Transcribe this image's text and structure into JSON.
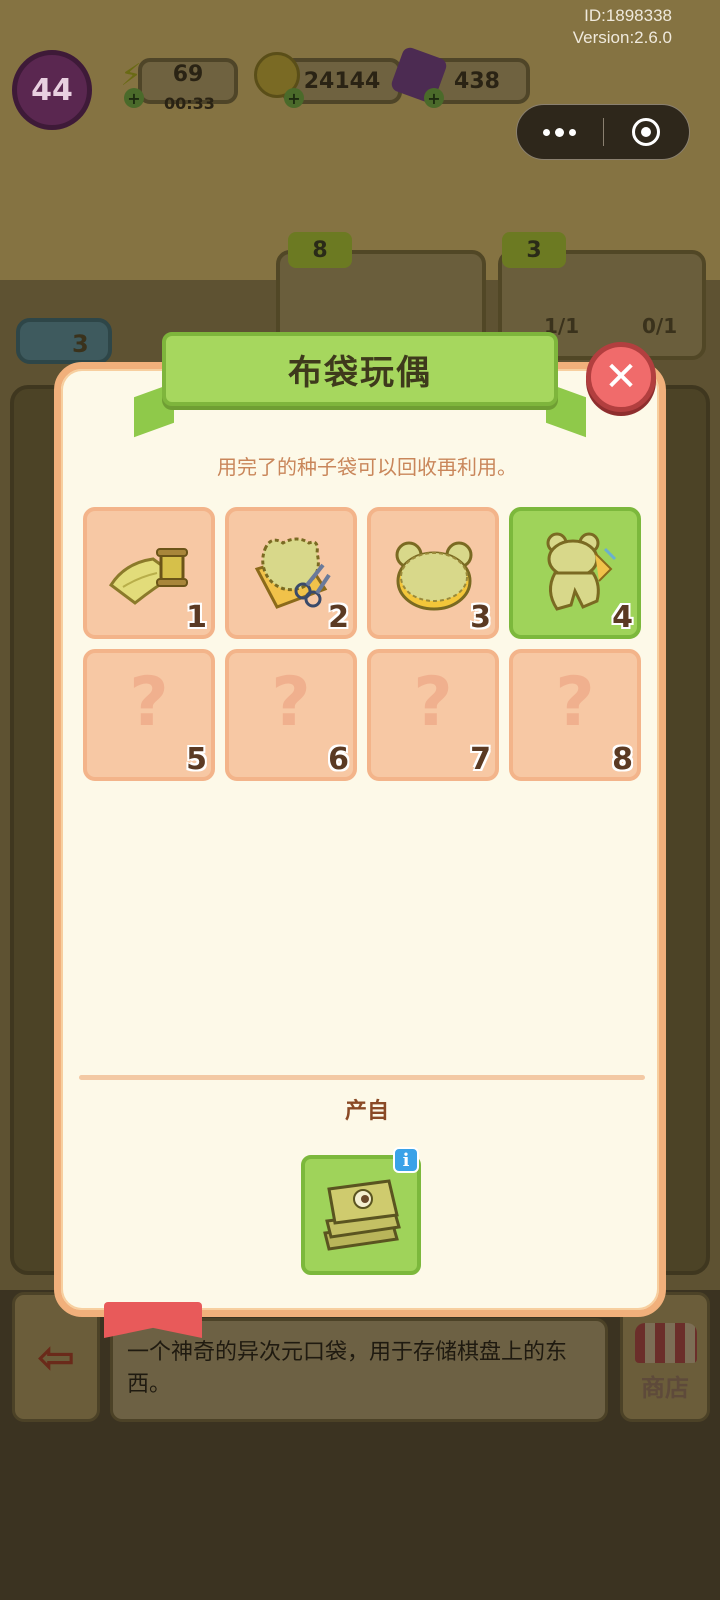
{
  "system": {
    "id_text": "ID:1898338",
    "version_text": "Version:2.6.0"
  },
  "hud": {
    "level": "44",
    "energy": {
      "value": "69",
      "timer": "00:33"
    },
    "coins": {
      "value": "24144"
    },
    "gems": {
      "value": "438"
    }
  },
  "background": {
    "order_badges": [
      "3",
      "8",
      "3"
    ],
    "counts": [
      "1/1",
      "0/1"
    ]
  },
  "modal": {
    "title": "布袋玩偶",
    "description": "用完了的种子袋可以回收再利用。",
    "items": [
      {
        "num": "1",
        "state": "unlocked",
        "icon": "fabric-roll-thread-icon"
      },
      {
        "num": "2",
        "state": "unlocked",
        "icon": "fabric-scissors-icon"
      },
      {
        "num": "3",
        "state": "unlocked",
        "icon": "bear-pattern-icon"
      },
      {
        "num": "4",
        "state": "selected",
        "icon": "bear-doll-icon"
      },
      {
        "num": "5",
        "state": "locked",
        "icon": "question-icon",
        "placeholder": "?"
      },
      {
        "num": "6",
        "state": "locked",
        "icon": "question-icon",
        "placeholder": "?"
      },
      {
        "num": "7",
        "state": "locked",
        "icon": "question-icon",
        "placeholder": "?"
      },
      {
        "num": "8",
        "state": "locked",
        "icon": "question-icon",
        "placeholder": "?"
      }
    ],
    "source_label": "产自",
    "source_icon": "seed-bag-stack-icon",
    "info_glyph": "i"
  },
  "bottom_bar": {
    "description": "一个神奇的异次元口袋，用于存储棋盘上的东西。",
    "shop_label": "商店"
  },
  "colors": {
    "panel_border": "#f1b07b",
    "panel_bg": "#fdf9e8",
    "ribbon_green": "#a6d75e",
    "cell_locked": "#f7c8a4",
    "cell_selected": "#9fd35a",
    "close_red": "#f06b6b"
  }
}
